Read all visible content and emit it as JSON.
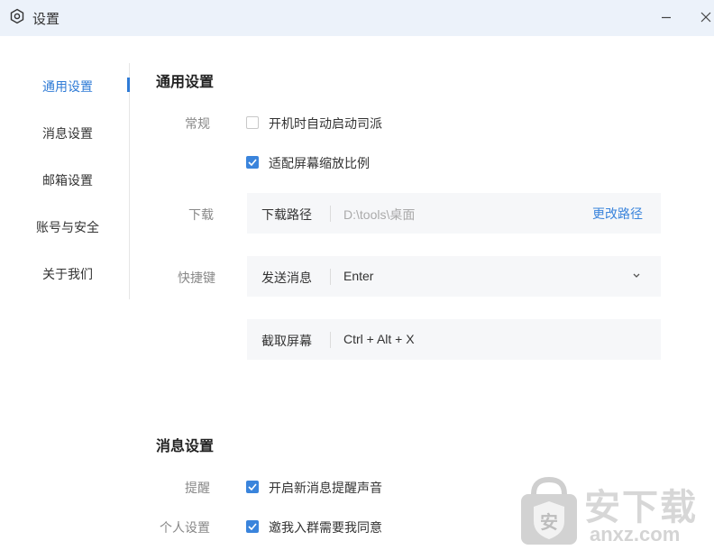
{
  "window": {
    "title": "设置",
    "icon": "gear-icon"
  },
  "sidebar": {
    "items": [
      {
        "label": "通用设置",
        "active": true
      },
      {
        "label": "消息设置",
        "active": false
      },
      {
        "label": "邮箱设置",
        "active": false
      },
      {
        "label": "账号与安全",
        "active": false
      },
      {
        "label": "关于我们",
        "active": false
      }
    ]
  },
  "general": {
    "title": "通用设置",
    "normal_label": "常规",
    "autostart": {
      "label": "开机时自动启动司派",
      "checked": false
    },
    "scaling": {
      "label": "适配屏幕缩放比例",
      "checked": true
    },
    "download_label": "下载",
    "download_path": {
      "label": "下载路径",
      "value": "D:\\tools\\桌面",
      "action": "更改路径"
    },
    "hotkey_label": "快捷键",
    "send_message": {
      "label": "发送消息",
      "value": "Enter"
    },
    "screenshot": {
      "label": "截取屏幕",
      "value": "Ctrl + Alt + X"
    }
  },
  "messages": {
    "title": "消息设置",
    "remind_label": "提醒",
    "sound": {
      "label": "开启新消息提醒声音",
      "checked": true
    },
    "personal_label": "个人设置",
    "group_invite": {
      "label": "邀我入群需要我同意",
      "checked": true
    }
  },
  "watermark": {
    "text": "安下载",
    "domain": "anxz.com",
    "badge": "安"
  },
  "colors": {
    "accent": "#3a84dc",
    "titlebar": "#ecf2fa",
    "field_bg": "#f6f7f9"
  }
}
